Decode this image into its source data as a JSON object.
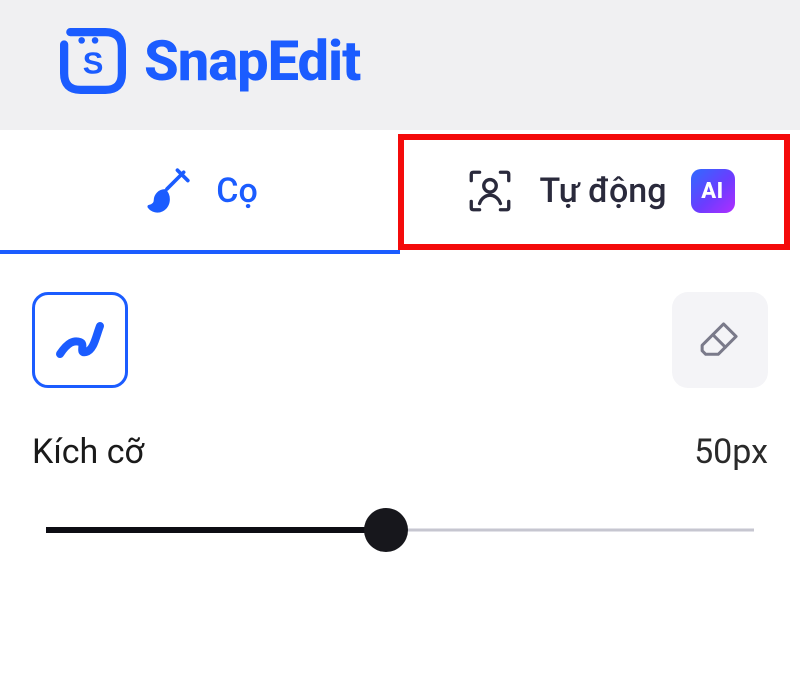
{
  "brand": {
    "name": "SnapEdit"
  },
  "tabs": [
    {
      "label": "Cọ",
      "active": true
    },
    {
      "label": "Tự động",
      "ai_badge": "AI",
      "highlighted": true
    }
  ],
  "tools": {
    "brush_active": true,
    "eraser_active": false
  },
  "size": {
    "label": "Kích cỡ",
    "value_display": "50px",
    "percent": 48
  },
  "colors": {
    "accent": "#1b5cff",
    "highlight_box": "#f40b0b"
  }
}
